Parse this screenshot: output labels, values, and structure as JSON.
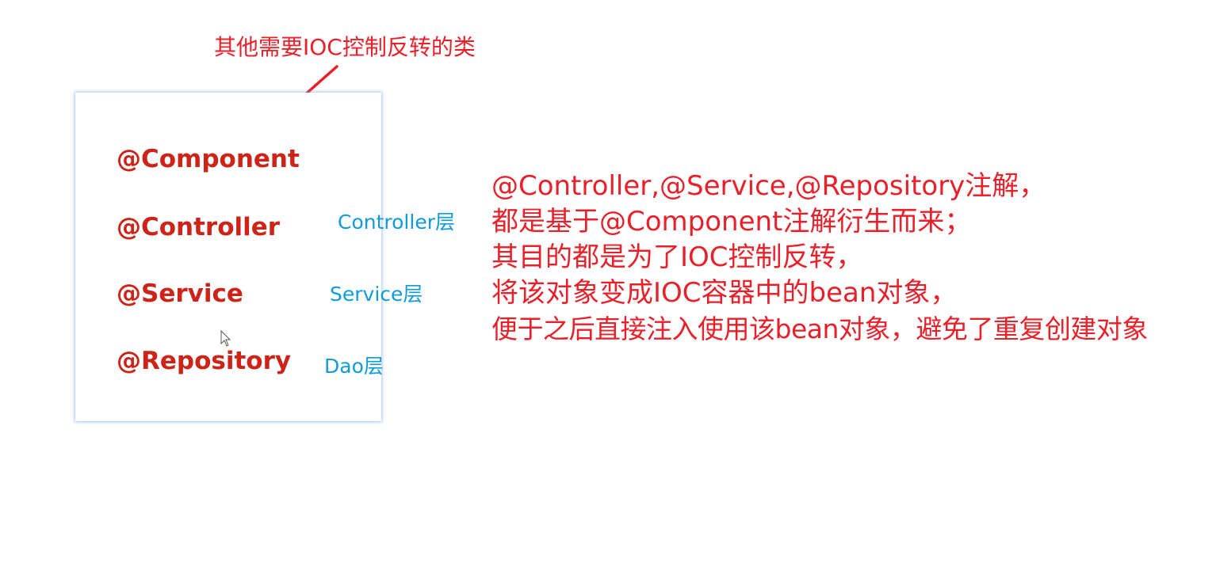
{
  "colors": {
    "red_text": "#e8202a",
    "anno_red": "#cc2418",
    "blue": "#0f9bd8",
    "arrow_red": "#e8202a"
  },
  "top_label": "其他需要IOC控制反转的类",
  "annotations": [
    {
      "id": "component",
      "text": "@Component"
    },
    {
      "id": "controller",
      "text": "@Controller"
    },
    {
      "id": "service",
      "text": "@Service"
    },
    {
      "id": "repository",
      "text": "@Repository"
    }
  ],
  "layer_labels": {
    "controller": "Controller层",
    "service": "Service层",
    "dao": "Dao层"
  },
  "description": [
    "@Controller,@Service,@Repository注解，",
    "都是基于@Component注解衍生而来；",
    "其目的都是为了IOC控制反转，",
    "将该对象变成IOC容器中的bean对象，",
    "便于之后直接注入使用该bean对象，避免了重复创建对象"
  ],
  "icons": {
    "cursor": "mouse-pointer-icon"
  }
}
